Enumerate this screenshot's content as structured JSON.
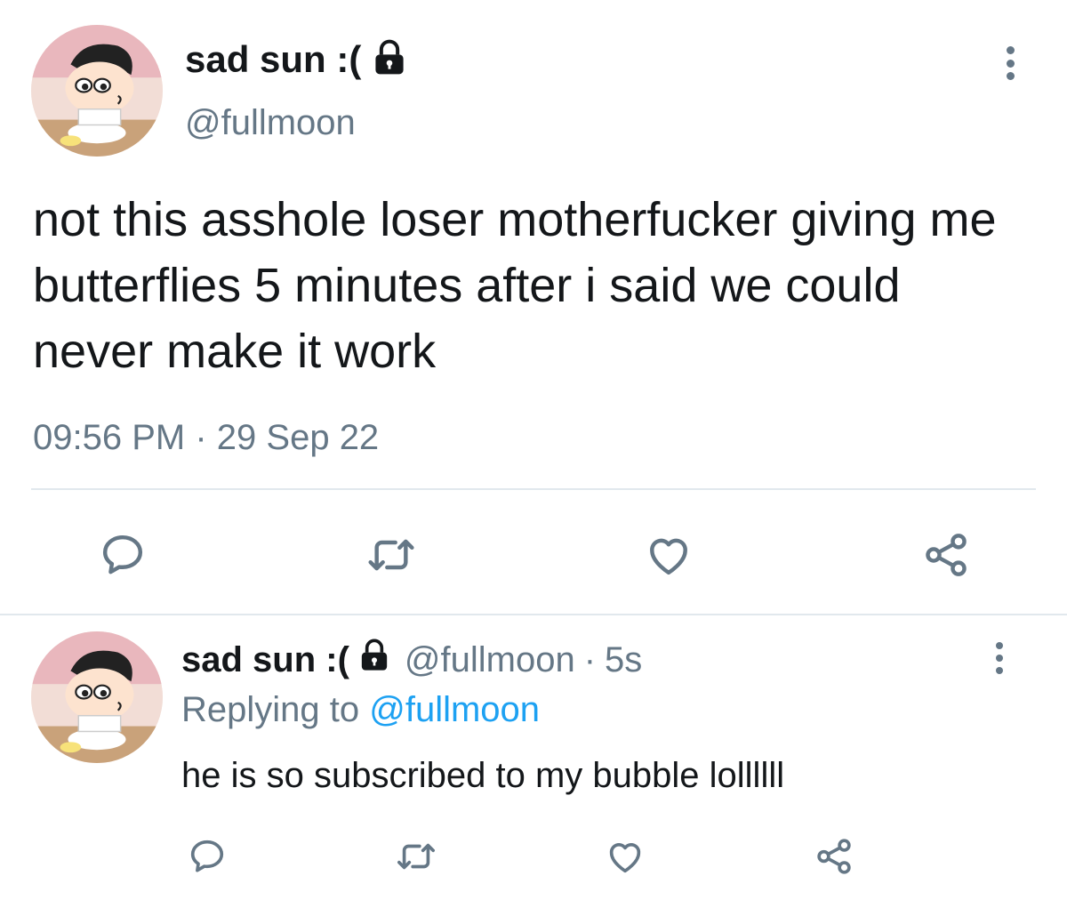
{
  "tweet": {
    "display_name": "sad sun :(",
    "handle": "@fullmoon",
    "text": "not this asshole loser motherfucker giving me butterflies 5 minutes after i said we could never make it work",
    "time": "09:56 PM",
    "separator": "·",
    "date": "29 Sep 22",
    "icons": {
      "lock": "lock-icon",
      "more": "more-vertical-icon",
      "reply": "reply-icon",
      "retweet": "retweet-icon",
      "like": "heart-icon",
      "share": "share-icon"
    }
  },
  "reply": {
    "display_name": "sad sun :(",
    "handle": "@fullmoon",
    "separator": "·",
    "age": "5s",
    "replying_prefix": "Replying to",
    "replying_handle": "@fullmoon",
    "text": "he is so subscribed to my bubble lollllll"
  },
  "colors": {
    "text": "#14171a",
    "muted": "#657786",
    "link": "#1da1f2",
    "divider": "#e1e8ed"
  }
}
